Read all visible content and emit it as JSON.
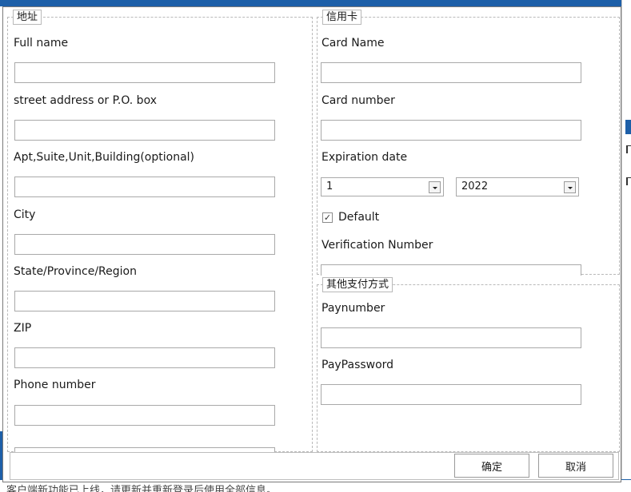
{
  "background": {
    "bottom_text": "客户端新功能已上线，请更新并重新登录后使用全部信息。"
  },
  "address": {
    "title": "地址",
    "full_name": {
      "label": "Full name",
      "value": ""
    },
    "street": {
      "label": "street address or P.O. box",
      "value": ""
    },
    "apt": {
      "label": "Apt,Suite,Unit,Building(optional)",
      "value": ""
    },
    "city": {
      "label": "City",
      "value": ""
    },
    "state": {
      "label": "State/Province/Region",
      "value": ""
    },
    "zip": {
      "label": "ZIP",
      "value": ""
    },
    "phone": {
      "label": "Phone number",
      "value": ""
    }
  },
  "credit_card": {
    "title": "信用卡",
    "card_name": {
      "label": "Card Name",
      "value": ""
    },
    "card_number": {
      "label": "Card number",
      "value": ""
    },
    "expiration": {
      "label": "Expiration date",
      "month": "1",
      "year": "2022"
    },
    "default": {
      "label": "Default",
      "checked": true,
      "mark": "✓"
    },
    "verification": {
      "label": "Verification Number",
      "value": ""
    }
  },
  "other_payment": {
    "title": "其他支付方式",
    "paynumber": {
      "label": "Paynumber",
      "value": ""
    },
    "paypassword": {
      "label": "PayPassword",
      "value": ""
    }
  },
  "footer": {
    "ok_label": "确定",
    "cancel_label": "取消"
  }
}
